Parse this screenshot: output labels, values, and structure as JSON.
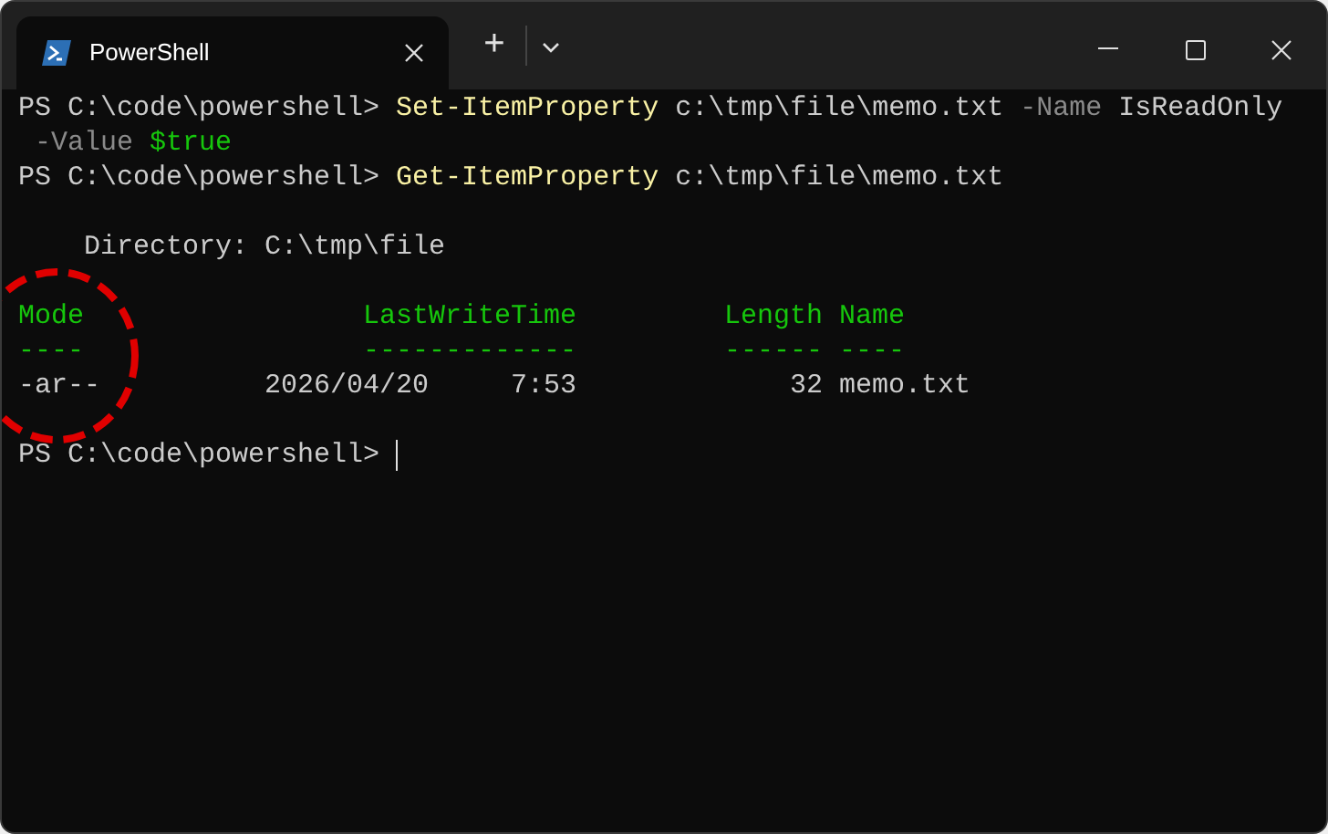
{
  "tabs": [
    {
      "title": "PowerShell",
      "selected": true
    }
  ],
  "new_tab": "+",
  "lines": [
    {
      "segments": [
        {
          "kind": "prompt",
          "text": "PS C:\\code\\powershell>"
        },
        {
          "kind": "command",
          "text": " Set-ItemProperty"
        },
        {
          "kind": "plain",
          "text": " c:\\tmp\\file\\memo.txt"
        },
        {
          "kind": "param",
          "text": " -Name"
        },
        {
          "kind": "plain",
          "text": " IsReadOnly"
        }
      ]
    },
    {
      "segments": [
        {
          "kind": "param",
          "text": " -Value"
        },
        {
          "kind": "variable",
          "text": " $true"
        }
      ]
    },
    {
      "segments": [
        {
          "kind": "prompt",
          "text": "PS C:\\code\\powershell>"
        },
        {
          "kind": "command",
          "text": " Get-ItemProperty"
        },
        {
          "kind": "plain",
          "text": " c:\\tmp\\file\\memo.txt"
        }
      ]
    },
    {
      "kind": "blank"
    },
    {
      "segments": [
        {
          "kind": "plain",
          "text": "    Directory: C:\\tmp\\file"
        }
      ]
    },
    {
      "kind": "blank"
    }
  ],
  "table": {
    "columns": [
      "Mode",
      "LastWriteTime",
      "Length",
      "Name"
    ],
    "rules": [
      "----",
      "-------------",
      "------",
      "----"
    ],
    "rows": [
      [
        "-ar--",
        "2026/04/20     7:53",
        "32",
        "memo.txt"
      ]
    ]
  },
  "final_prompt": "PS C:\\code\\powershell>"
}
